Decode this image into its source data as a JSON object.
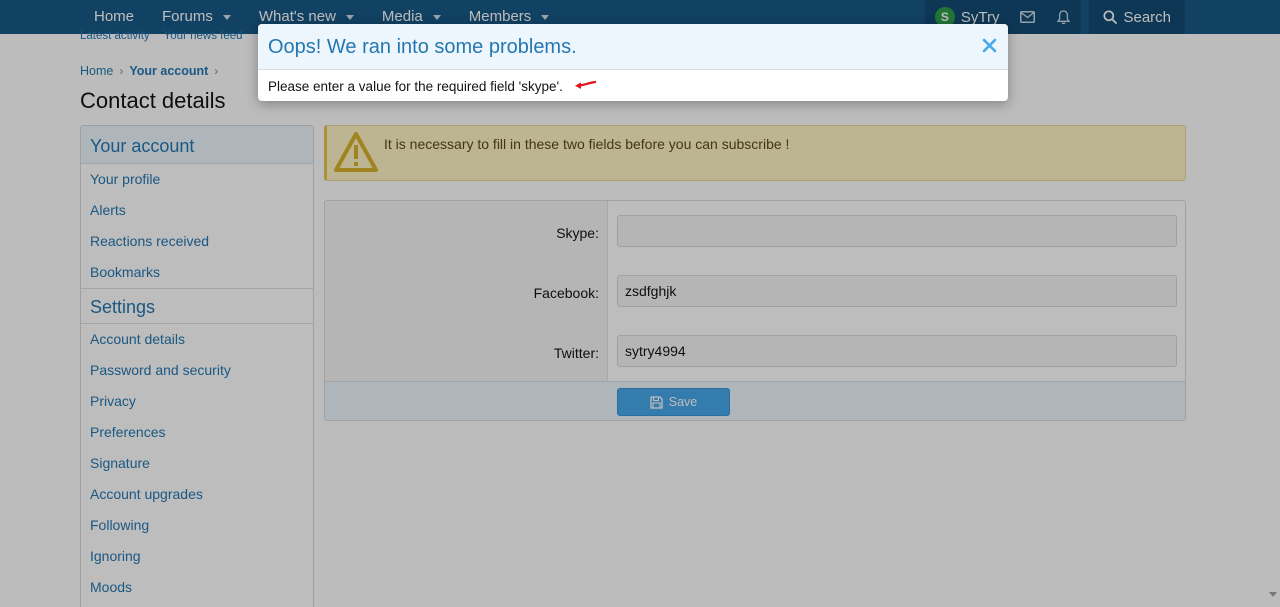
{
  "nav": {
    "home": "Home",
    "forums": "Forums",
    "whats_new": "What's new",
    "media": "Media",
    "members": "Members",
    "username": "SyTry",
    "avatar_letter": "S",
    "search": "Search"
  },
  "subnav": {
    "latest_activity": "Latest activity",
    "news_feed": "Your news feed"
  },
  "breadcrumb": {
    "home": "Home",
    "current": "Your account"
  },
  "page_title": "Contact details",
  "sidebar": {
    "heading": "Your account",
    "items": [
      "Your profile",
      "Alerts",
      "Reactions received",
      "Bookmarks"
    ],
    "settings_heading": "Settings",
    "settings_items": [
      "Account details",
      "Password and security",
      "Privacy",
      "Preferences",
      "Signature",
      "Account upgrades",
      "Following",
      "Ignoring",
      "Moods"
    ]
  },
  "notice": {
    "text": "It is necessary to fill in these two fields before you can subscribe !"
  },
  "form": {
    "skype_label": "Skype:",
    "skype_value": "",
    "facebook_label": "Facebook:",
    "facebook_value": "zsdfghjk",
    "twitter_label": "Twitter:",
    "twitter_value": "sytry4994",
    "save_label": "Save"
  },
  "modal": {
    "title": "Oops! We ran into some problems.",
    "message": "Please enter a value for the required field 'skype'."
  },
  "colors": {
    "header": "#185886",
    "accent": "#2577b1",
    "button": "#47a7eb",
    "notice_bg": "#fff3c5",
    "arrow": "#e0141e"
  }
}
